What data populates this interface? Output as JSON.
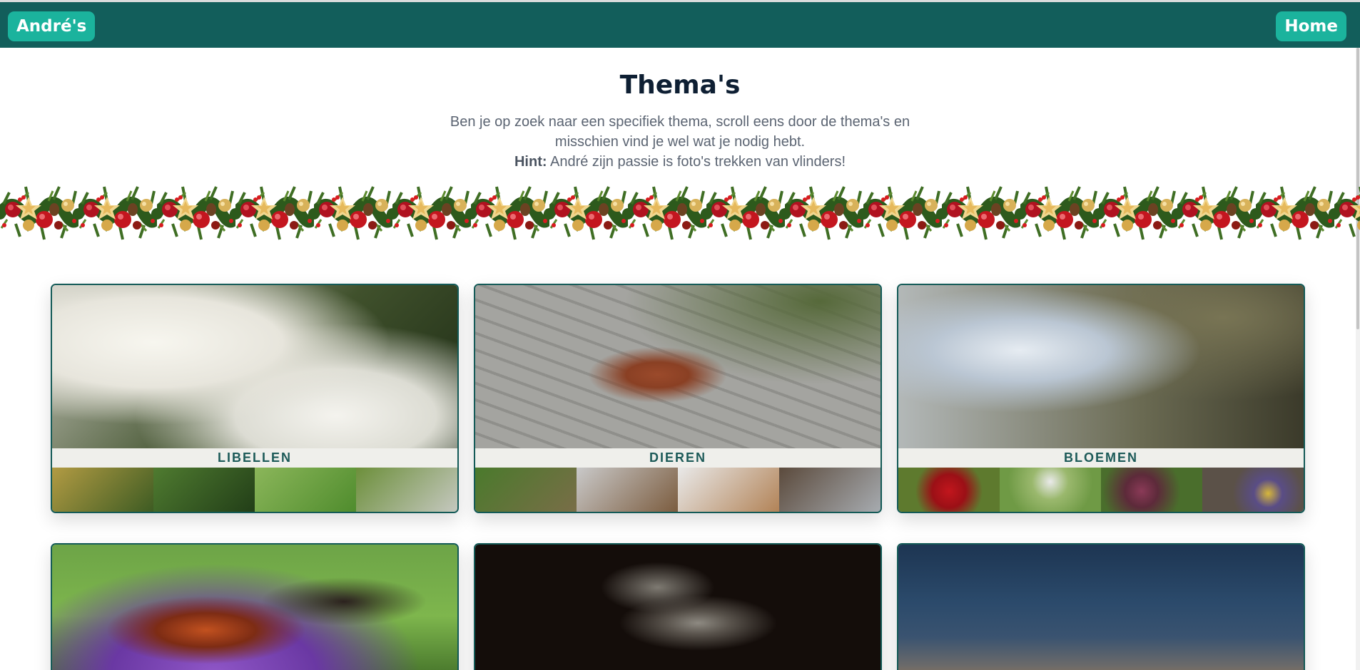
{
  "nav": {
    "brand": "André's",
    "home": "Home"
  },
  "header": {
    "title": "Thema's",
    "intro": "Ben je op zoek naar een specifiek thema, scroll eens door de thema's en misschien vind je wel wat je nodig hebt.",
    "hint_label": "Hint:",
    "hint_text": "André zijn passie is foto's trekken van vlinders!"
  },
  "themes": [
    {
      "label": "LIBELLEN"
    },
    {
      "label": "DIEREN"
    },
    {
      "label": "BLOEMEN"
    }
  ],
  "colors": {
    "navbar": "#125e5b",
    "button": "#1bb39d",
    "label_text": "#1c5a58",
    "title": "#0e1f33",
    "body_text": "#5b6472"
  }
}
